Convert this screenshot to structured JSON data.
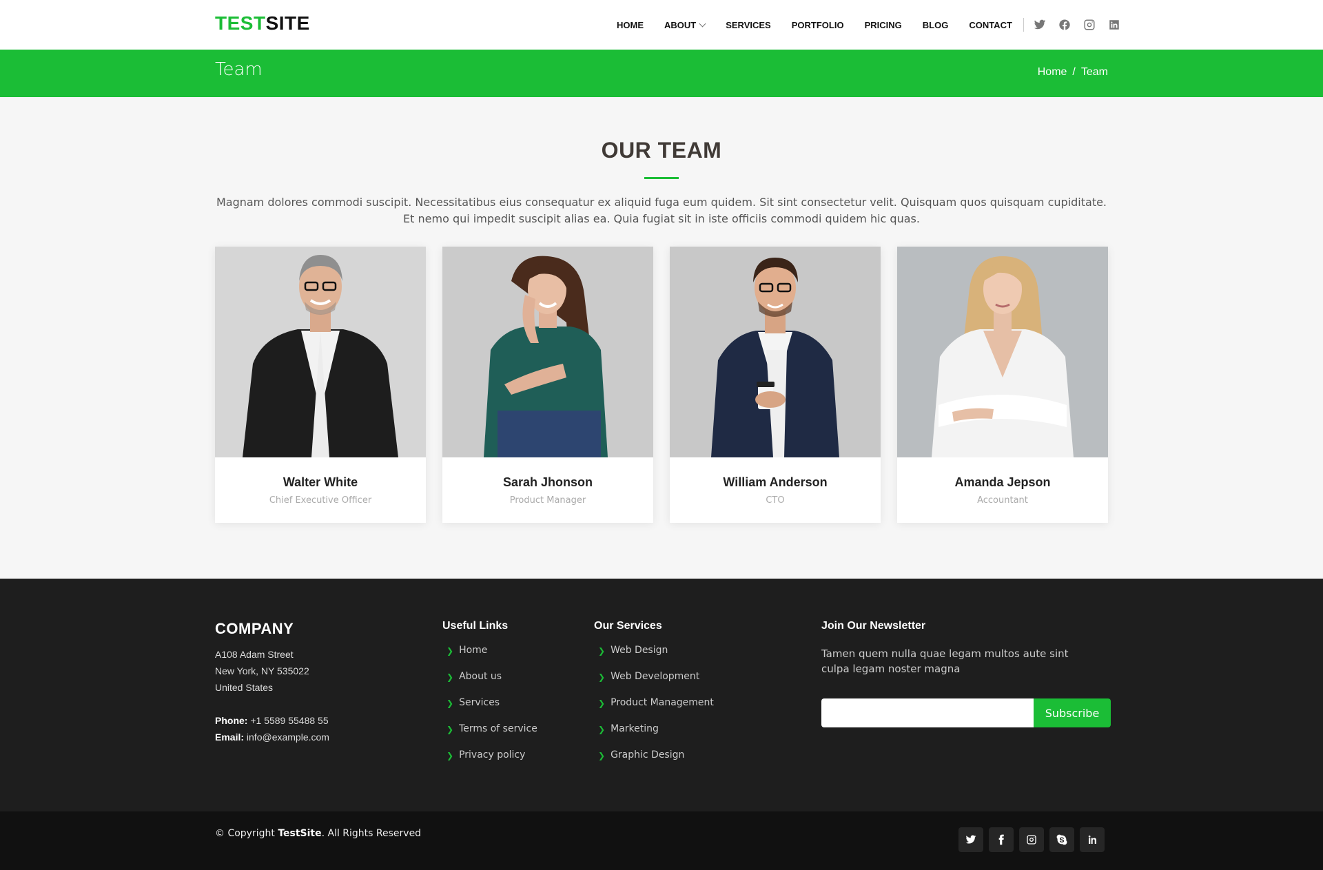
{
  "header": {
    "logo_accent": "TEST",
    "logo_rest": "SITE",
    "nav": [
      "HOME",
      "ABOUT",
      "SERVICES",
      "PORTFOLIO",
      "PRICING",
      "BLOG",
      "CONTACT"
    ],
    "social_icons": [
      "twitter-icon",
      "facebook-icon",
      "instagram-icon",
      "linkedin-icon"
    ]
  },
  "banner": {
    "title": "Team",
    "breadcrumb": [
      "Home",
      "/",
      "Team"
    ]
  },
  "team": {
    "heading": "OUR TEAM",
    "description": "Magnam dolores commodi suscipit. Necessitatibus eius consequatur ex aliquid fuga eum quidem. Sit sint consectetur velit. Quisquam quos quisquam cupiditate. Et nemo qui impedit suscipit alias ea. Quia fugiat sit in iste officiis commodi quidem hic quas.",
    "members": [
      {
        "name": "Walter White",
        "role": "Chief Executive Officer"
      },
      {
        "name": "Sarah Jhonson",
        "role": "Product Manager"
      },
      {
        "name": "William Anderson",
        "role": "CTO"
      },
      {
        "name": "Amanda Jepson",
        "role": "Accountant"
      }
    ]
  },
  "footer": {
    "company": "COMPANY",
    "address": [
      "A108 Adam Street",
      "New York, NY 535022",
      "United States"
    ],
    "phone_label": "Phone:",
    "phone": "+1 5589 55488 55",
    "email_label": "Email:",
    "email": "info@example.com",
    "useful_links_title": "Useful Links",
    "useful_links": [
      "Home",
      "About us",
      "Services",
      "Terms of service",
      "Privacy policy"
    ],
    "services_title": "Our Services",
    "services": [
      "Web Design",
      "Web Development",
      "Product Management",
      "Marketing",
      "Graphic Design"
    ],
    "newsletter_title": "Join Our Newsletter",
    "newsletter_text": "Tamen quem nulla quae legam multos aute sint culpa legam noster magna",
    "newsletter_input": "",
    "subscribe_label": "Subscribe"
  },
  "bottom": {
    "copyright_prefix": "© Copyright ",
    "copyright_brand": "TestSite",
    "copyright_suffix": ". All Rights Reserved",
    "social_icons": [
      "twitter-icon",
      "facebook-icon",
      "instagram-icon",
      "skype-icon",
      "linkedin-icon"
    ]
  },
  "colors": {
    "accent": "#1bbd36",
    "footer_bg": "#1e1e1e",
    "bottom_bg": "#111111"
  }
}
